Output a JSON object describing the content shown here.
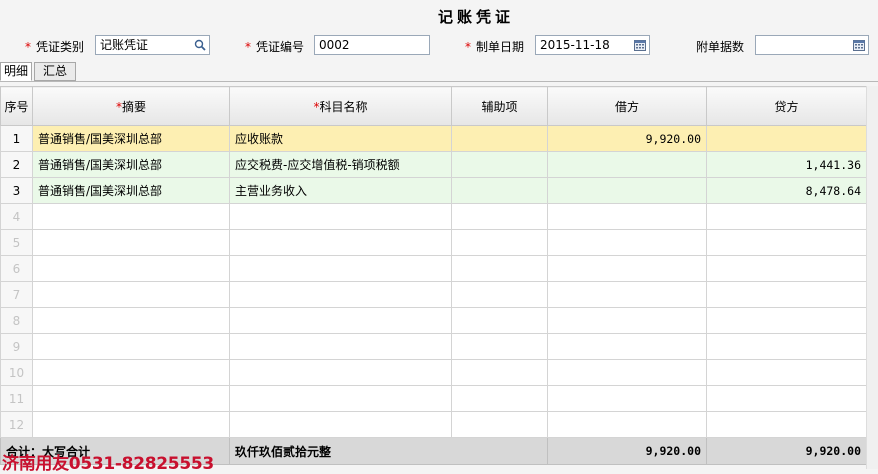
{
  "title": "记账凭证",
  "fields": {
    "type_label": "凭证类别",
    "type_value": "记账凭证",
    "number_label": "凭证编号",
    "number_value": "0002",
    "date_label": "制单日期",
    "date_value": "2015-11-18",
    "attach_label": "附单据数",
    "attach_value": ""
  },
  "tabs": [
    "明细",
    "汇总"
  ],
  "columns": [
    "序号",
    "摘要",
    "科目名称",
    "辅助项",
    "借方",
    "贷方"
  ],
  "rows": [
    {
      "seq": "1",
      "summary": "普通销售/国美深圳总部",
      "account": "应收账款",
      "aux": "",
      "debit": "9,920.00",
      "credit": ""
    },
    {
      "seq": "2",
      "summary": "普通销售/国美深圳总部",
      "account": "应交税费-应交增值税-销项税额",
      "aux": "",
      "debit": "",
      "credit": "1,441.36"
    },
    {
      "seq": "3",
      "summary": "普通销售/国美深圳总部",
      "account": "主营业务收入",
      "aux": "",
      "debit": "",
      "credit": "8,478.64"
    },
    {
      "seq": "4",
      "summary": "",
      "account": "",
      "aux": "",
      "debit": "",
      "credit": ""
    },
    {
      "seq": "5",
      "summary": "",
      "account": "",
      "aux": "",
      "debit": "",
      "credit": ""
    },
    {
      "seq": "6",
      "summary": "",
      "account": "",
      "aux": "",
      "debit": "",
      "credit": ""
    },
    {
      "seq": "7",
      "summary": "",
      "account": "",
      "aux": "",
      "debit": "",
      "credit": ""
    },
    {
      "seq": "8",
      "summary": "",
      "account": "",
      "aux": "",
      "debit": "",
      "credit": ""
    },
    {
      "seq": "9",
      "summary": "",
      "account": "",
      "aux": "",
      "debit": "",
      "credit": ""
    },
    {
      "seq": "10",
      "summary": "",
      "account": "",
      "aux": "",
      "debit": "",
      "credit": ""
    },
    {
      "seq": "11",
      "summary": "",
      "account": "",
      "aux": "",
      "debit": "",
      "credit": ""
    },
    {
      "seq": "12",
      "summary": "",
      "account": "",
      "aux": "",
      "debit": "",
      "credit": ""
    }
  ],
  "total": {
    "label": "合计：大写合计",
    "amount_words": "玖仟玖佰贰拾元整",
    "debit": "9,920.00",
    "credit": "9,920.00"
  },
  "watermark": "济南用友0531-82825553",
  "icons": {
    "type_lookup": "search-icon",
    "date_picker": "calendar-icon",
    "attach_picker": "calendar-icon"
  }
}
